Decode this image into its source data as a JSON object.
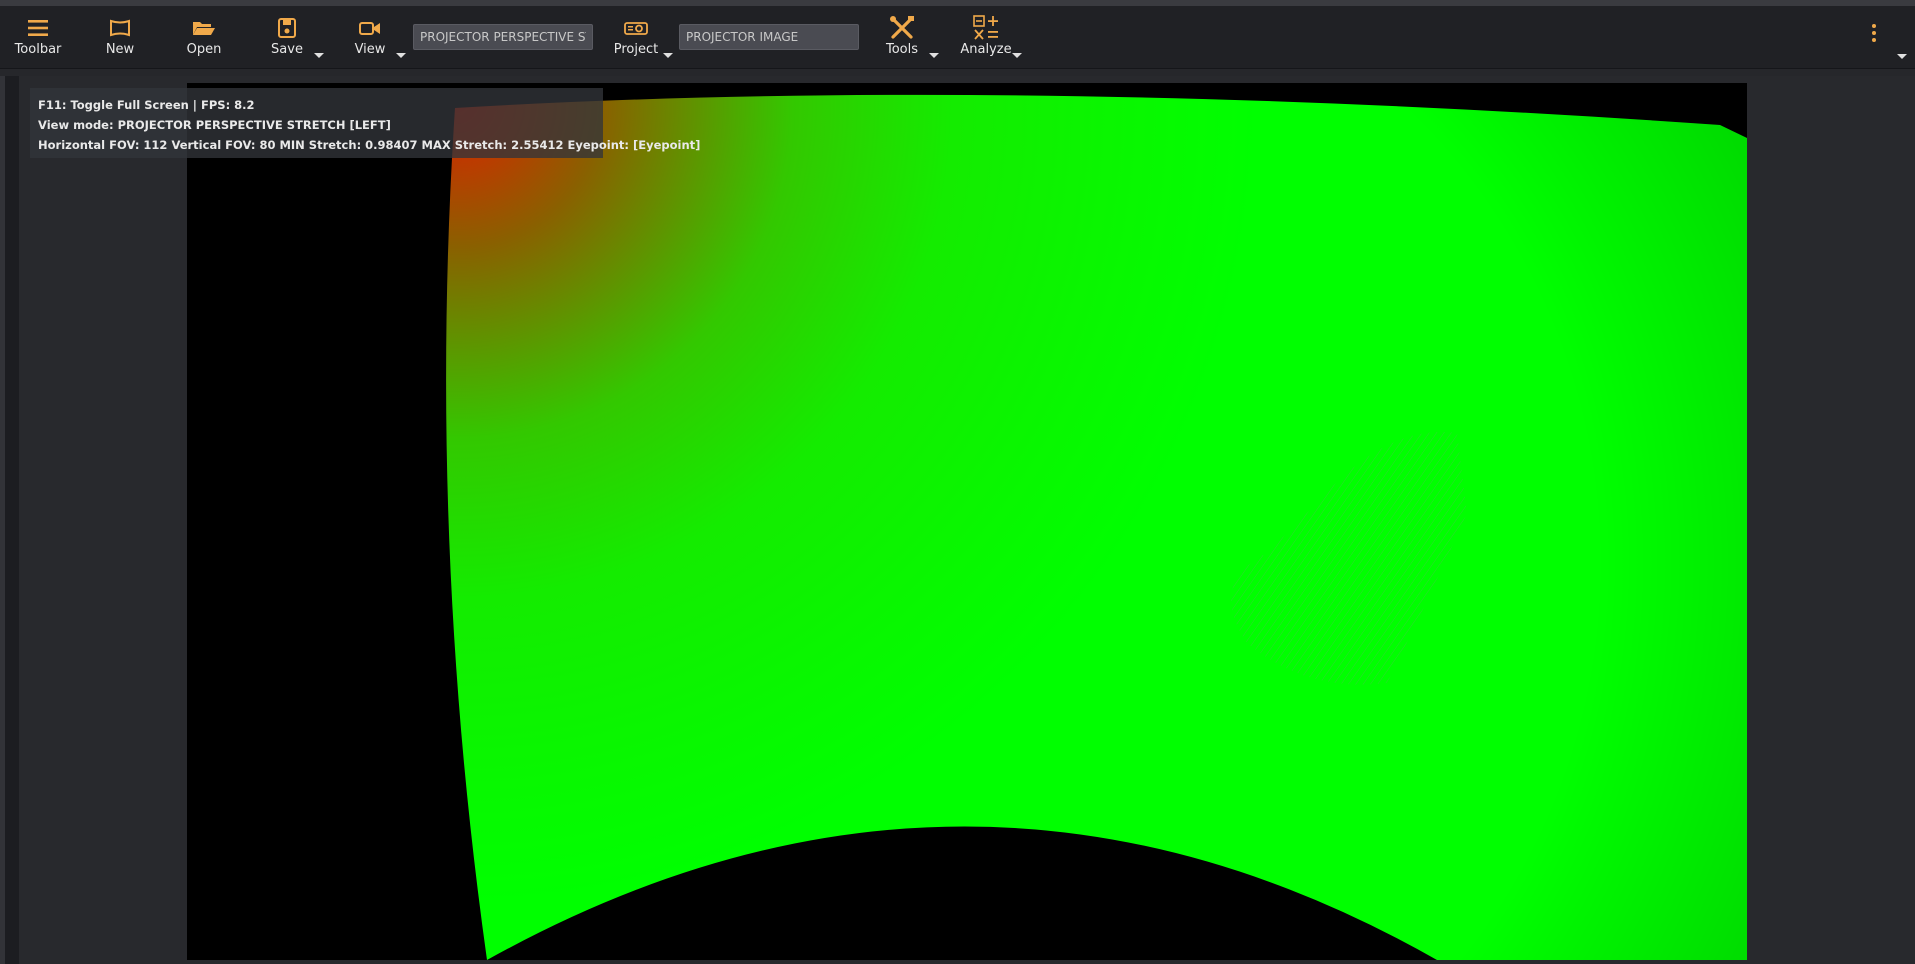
{
  "toolbar": {
    "buttons": {
      "toolbar": {
        "label": "Toolbar",
        "icon": "hamburger-menu-icon"
      },
      "new": {
        "label": "New",
        "icon": "new-canvas-icon"
      },
      "open": {
        "label": "Open",
        "icon": "folder-open-icon"
      },
      "save": {
        "label": "Save",
        "icon": "floppy-disk-icon"
      },
      "view": {
        "label": "View",
        "icon": "video-camera-icon"
      },
      "project": {
        "label": "Project",
        "icon": "projector-icon"
      },
      "tools": {
        "label": "Tools",
        "icon": "wrench-screwdriver-icon"
      },
      "analyze": {
        "label": "Analyze",
        "icon": "calculator-icon"
      }
    },
    "view_mode_field": "PROJECTOR PERSPECTIVE ST",
    "project_image_field": "PROJECTOR IMAGE",
    "accent_color": "#f0a94a"
  },
  "overlay": {
    "line1": "F11: Toggle Full Screen | FPS: 8.2",
    "line2": "View mode: PROJECTOR PERSPECTIVE STRETCH [LEFT]",
    "line3": "Horizontal FOV: 112 Vertical FOV: 80 MIN Stretch: 0.98407 MAX Stretch: 2.55412 Eyepoint: [Eyepoint]"
  },
  "viewport": {
    "background": "#000000",
    "stretch_low_color": "#00ff00",
    "stretch_high_color": "#e02000"
  }
}
